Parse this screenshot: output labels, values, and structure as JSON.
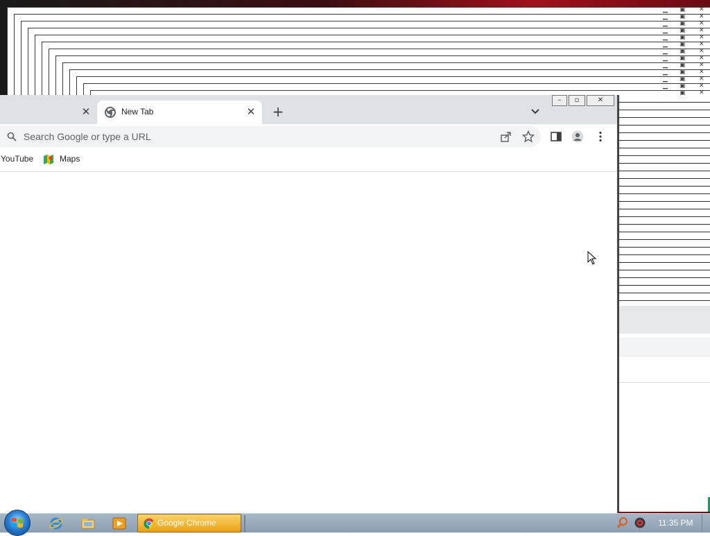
{
  "browser": {
    "tabs": [
      {
        "label": "",
        "active": false
      },
      {
        "label": "New Tab",
        "active": true
      }
    ],
    "omnibox": {
      "placeholder": "Search Google or type a URL",
      "value": ""
    },
    "bookmarks": [
      {
        "label": "YouTube",
        "icon": "youtube-icon"
      },
      {
        "label": "Maps",
        "icon": "maps-icon"
      }
    ]
  },
  "taskbar": {
    "running_app": "Google Chrome",
    "clock": "11:35 PM"
  },
  "colors": {
    "tabstrip": "#dee1e6",
    "omnibox": "#f1f3f4",
    "taskbar_active": "#e9a012"
  }
}
